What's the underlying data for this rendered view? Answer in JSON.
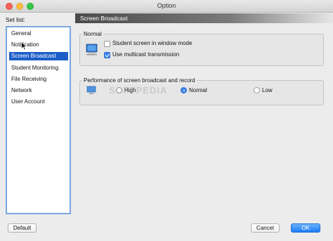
{
  "window": {
    "title": "Option"
  },
  "sidebar": {
    "label": "Set list:",
    "items": [
      {
        "label": "General"
      },
      {
        "label": "Notification"
      },
      {
        "label": "Screen Broadcast",
        "selected": true
      },
      {
        "label": "Student Monitoring"
      },
      {
        "label": "File Receiving"
      },
      {
        "label": "Network"
      },
      {
        "label": "User Account"
      }
    ]
  },
  "header": {
    "title": "Screen Broadcast"
  },
  "normal_group": {
    "legend": "Normal",
    "window_mode": {
      "label": "Student screen in window mode",
      "checked": false
    },
    "multicast": {
      "label": "Use multicast transmission",
      "checked": true
    }
  },
  "performance_group": {
    "legend": "Performance of screen broadcast and record",
    "options": [
      {
        "label": "High",
        "selected": false
      },
      {
        "label": "Normal",
        "selected": true
      },
      {
        "label": "Low",
        "selected": false
      }
    ]
  },
  "watermark": "SOFTPEDIA",
  "buttons": {
    "default": "Default",
    "cancel": "Cancel",
    "ok": "OK"
  },
  "colors": {
    "selection": "#1d5ec8",
    "accent": "#3b86ef",
    "ok_button": "#1b7cf2"
  }
}
